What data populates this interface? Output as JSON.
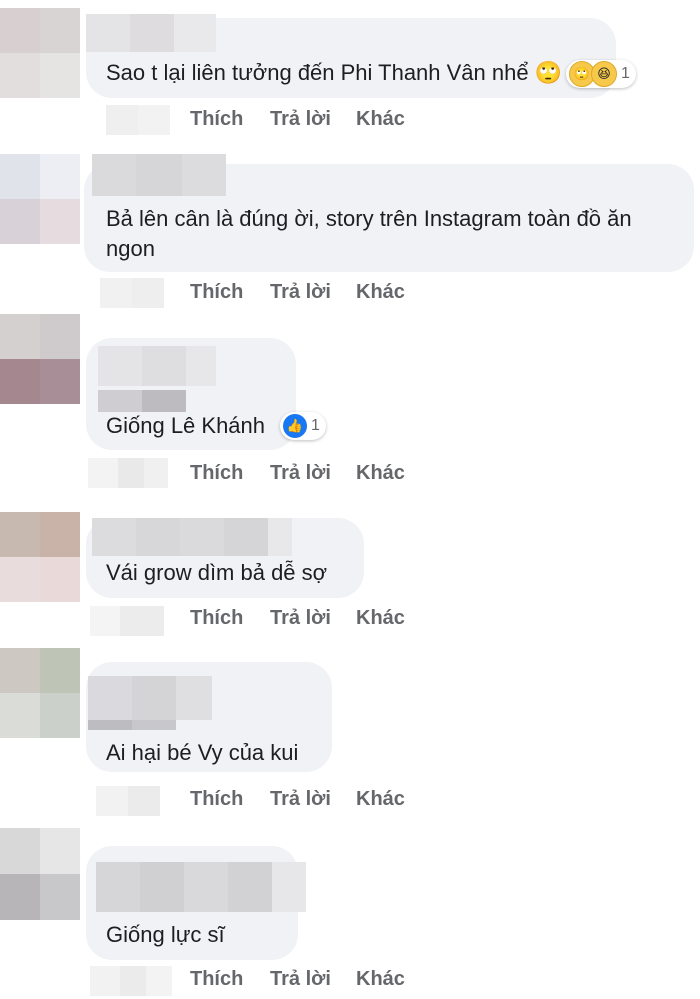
{
  "comments": [
    {
      "text": "Sao t lại liên tưởng đến Phi Thanh Vân nhể 🙄",
      "reactions": [
        "roll-eyes",
        "haha"
      ],
      "reaction_count": "1"
    },
    {
      "text": "Bả lên cân là đúng ời, story trên Instagram toàn đồ ăn ngon"
    },
    {
      "text": "Giống Lê Khánh",
      "reactions": [
        "like"
      ],
      "reaction_count": "1"
    },
    {
      "text": "Vái grow dìm bả dễ sợ"
    },
    {
      "text": "Ai hại bé Vy của kui"
    },
    {
      "text": "Giống lực sĩ"
    }
  ],
  "actions": {
    "like": "Thích",
    "reply": "Trả lời",
    "more": "Khác"
  },
  "colors": {
    "bubble": "#f0f2f5",
    "action_text": "#65676b",
    "text": "#1c1e21",
    "like_blue": "#1877f2"
  }
}
